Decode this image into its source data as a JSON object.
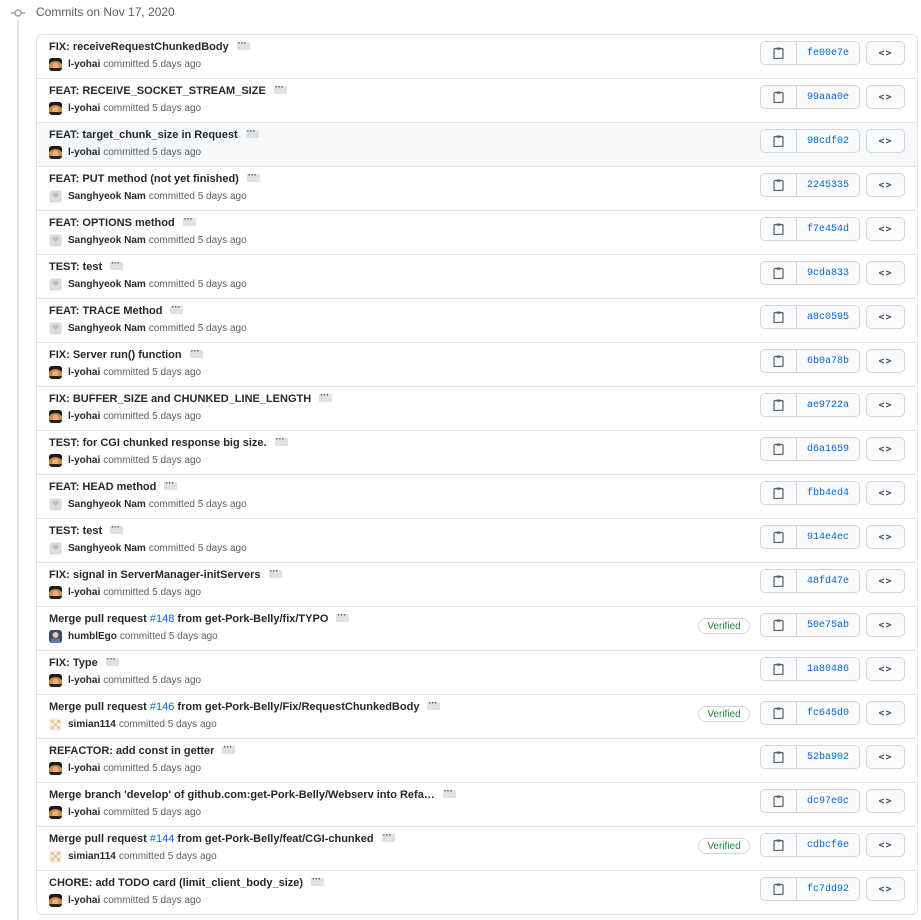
{
  "date_header": "Commits on Nov 17, 2020",
  "commits": [
    {
      "message": "FIX: receiveRequestChunkedBody",
      "issue": "",
      "message_suffix": "",
      "author": "l-yohai",
      "avatar": "yohai",
      "time": "committed 5 days ago",
      "verified": "",
      "sha": "fe00e7e",
      "highlight": false
    },
    {
      "message": "FEAT: RECEIVE_SOCKET_STREAM_SIZE",
      "issue": "",
      "message_suffix": "",
      "author": "l-yohai",
      "avatar": "yohai",
      "time": "committed 5 days ago",
      "verified": "",
      "sha": "99aaa0e",
      "highlight": false
    },
    {
      "message": "FEAT: target_chunk_size in Request",
      "issue": "",
      "message_suffix": "",
      "author": "l-yohai",
      "avatar": "yohai",
      "time": "committed 5 days ago",
      "verified": "",
      "sha": "98cdf02",
      "highlight": true
    },
    {
      "message": "FEAT: PUT method (not yet finished)",
      "issue": "",
      "message_suffix": "",
      "author": "Sanghyeok Nam",
      "avatar": "nam",
      "time": "committed 5 days ago",
      "verified": "",
      "sha": "2245335",
      "highlight": false
    },
    {
      "message": "FEAT: OPTIONS method",
      "issue": "",
      "message_suffix": "",
      "author": "Sanghyeok Nam",
      "avatar": "nam",
      "time": "committed 5 days ago",
      "verified": "",
      "sha": "f7e454d",
      "highlight": false
    },
    {
      "message": "TEST: test",
      "issue": "",
      "message_suffix": "",
      "author": "Sanghyeok Nam",
      "avatar": "nam",
      "time": "committed 5 days ago",
      "verified": "",
      "sha": "9cda833",
      "highlight": false
    },
    {
      "message": "FEAT: TRACE Method",
      "issue": "",
      "message_suffix": "",
      "author": "Sanghyeok Nam",
      "avatar": "nam",
      "time": "committed 5 days ago",
      "verified": "",
      "sha": "a8c0595",
      "highlight": false
    },
    {
      "message": "FIX: Server run() function",
      "issue": "",
      "message_suffix": "",
      "author": "l-yohai",
      "avatar": "yohai",
      "time": "committed 5 days ago",
      "verified": "",
      "sha": "6b0a78b",
      "highlight": false
    },
    {
      "message": "FIX: BUFFER_SIZE and CHUNKED_LINE_LENGTH",
      "issue": "",
      "message_suffix": "",
      "author": "l-yohai",
      "avatar": "yohai",
      "time": "committed 5 days ago",
      "verified": "",
      "sha": "ae9722a",
      "highlight": false
    },
    {
      "message": "TEST: for CGI chunked response big size.",
      "issue": "",
      "message_suffix": "",
      "author": "l-yohai",
      "avatar": "yohai",
      "time": "committed 5 days ago",
      "verified": "",
      "sha": "d6a1659",
      "highlight": false
    },
    {
      "message": "FEAT: HEAD method",
      "issue": "",
      "message_suffix": "",
      "author": "Sanghyeok Nam",
      "avatar": "nam",
      "time": "committed 5 days ago",
      "verified": "",
      "sha": "fbb4ed4",
      "highlight": false
    },
    {
      "message": "TEST: test",
      "issue": "",
      "message_suffix": "",
      "author": "Sanghyeok Nam",
      "avatar": "nam",
      "time": "committed 5 days ago",
      "verified": "",
      "sha": "914e4ec",
      "highlight": false
    },
    {
      "message": "FIX: signal in ServerManager-initServers",
      "issue": "",
      "message_suffix": "",
      "author": "l-yohai",
      "avatar": "yohai",
      "time": "committed 5 days ago",
      "verified": "",
      "sha": "48fd47e",
      "highlight": false
    },
    {
      "message": "Merge pull request ",
      "issue": "#148",
      "message_suffix": " from get-Pork-Belly/fix/TYPO",
      "author": "humblEgo",
      "avatar": "humble",
      "time": "committed 5 days ago",
      "verified": "Verified",
      "sha": "50e75ab",
      "highlight": false
    },
    {
      "message": "FIX: Type",
      "issue": "",
      "message_suffix": "",
      "author": "l-yohai",
      "avatar": "yohai",
      "time": "committed 5 days ago",
      "verified": "",
      "sha": "1a80486",
      "highlight": false
    },
    {
      "message": "Merge pull request ",
      "issue": "#146",
      "message_suffix": " from get-Pork-Belly/Fix/RequestChunkedBody",
      "author": "simian114",
      "avatar": "simian",
      "time": "committed 5 days ago",
      "verified": "Verified",
      "sha": "fc645d0",
      "highlight": false
    },
    {
      "message": "REFACTOR: add const in getter",
      "issue": "",
      "message_suffix": "",
      "author": "l-yohai",
      "avatar": "yohai",
      "time": "committed 5 days ago",
      "verified": "",
      "sha": "52ba902",
      "highlight": false
    },
    {
      "message": "Merge branch 'develop' of github.com:get-Pork-Belly/Webserv into Refa…",
      "issue": "",
      "message_suffix": "",
      "author": "l-yohai",
      "avatar": "yohai",
      "time": "committed 5 days ago",
      "verified": "",
      "sha": "dc97e0c",
      "highlight": false
    },
    {
      "message": "Merge pull request ",
      "issue": "#144",
      "message_suffix": " from get-Pork-Belly/feat/CGI-chunked",
      "author": "simian114",
      "avatar": "simian",
      "time": "committed 5 days ago",
      "verified": "Verified",
      "sha": "cdbcf6e",
      "highlight": false
    },
    {
      "message": "CHORE: add TODO card (limit_client_body_size)",
      "issue": "",
      "message_suffix": "",
      "author": "l-yohai",
      "avatar": "yohai",
      "time": "committed 5 days ago",
      "verified": "",
      "sha": "fc7dd92",
      "highlight": false
    }
  ],
  "icons": {
    "copy": "clipboard-icon",
    "browse": "code-icon",
    "timeline": "git-commit-icon",
    "expand": "ellipsis-icon"
  },
  "colors": {
    "link": "#0366d6",
    "verified": "#22863a",
    "border": "#e1e4e8",
    "highlight": "#f6f8fa"
  }
}
